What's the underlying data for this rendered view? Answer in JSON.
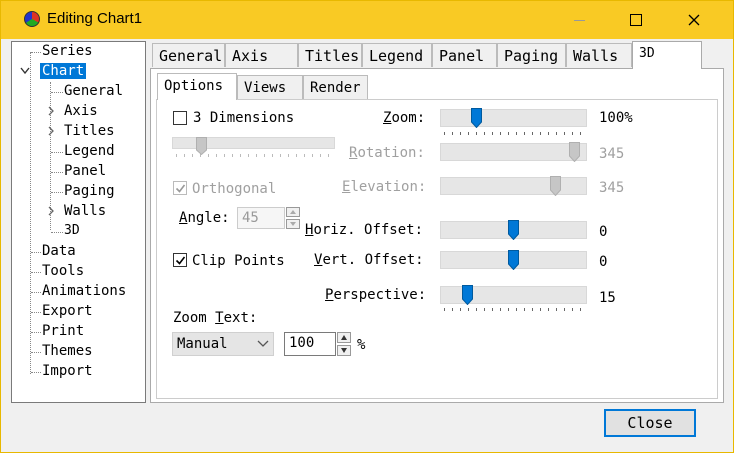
{
  "window": {
    "title": "Editing Chart1"
  },
  "tree": {
    "items": [
      {
        "label": "Series"
      },
      {
        "label": "Chart"
      },
      {
        "label": "General"
      },
      {
        "label": "Axis"
      },
      {
        "label": "Titles"
      },
      {
        "label": "Legend"
      },
      {
        "label": "Panel"
      },
      {
        "label": "Paging"
      },
      {
        "label": "Walls"
      },
      {
        "label": "3D"
      },
      {
        "label": "Data"
      },
      {
        "label": "Tools"
      },
      {
        "label": "Animations"
      },
      {
        "label": "Export"
      },
      {
        "label": "Print"
      },
      {
        "label": "Themes"
      },
      {
        "label": "Import"
      }
    ],
    "selected": "Chart"
  },
  "tabs": [
    "General",
    "Axis",
    "Titles",
    "Legend",
    "Panel",
    "Paging",
    "Walls",
    "3D"
  ],
  "active_tab": "3D",
  "subtabs": [
    "Options",
    "Views",
    "Render"
  ],
  "active_subtab": "Options",
  "options": {
    "three_dimensions": {
      "label": "3 Dimensions",
      "checked": false
    },
    "orthogonal": {
      "label": "Orthogonal",
      "checked": true,
      "enabled": false
    },
    "angle": {
      "label": "Angle:",
      "value": "45",
      "enabled": false
    },
    "clip_points": {
      "label": "Clip Points",
      "checked": true
    },
    "zoom_text": {
      "label": "Zoom Text:",
      "value": "Manual"
    },
    "zoom_text_percent": {
      "value": "100",
      "unit": "%"
    },
    "sliders": {
      "zoom": {
        "label": "Zoom:",
        "value": "100%",
        "level": 0.22,
        "enabled": true
      },
      "rotation": {
        "label": "Rotation:",
        "value": "345",
        "level": 0.96,
        "enabled": false
      },
      "elevation": {
        "label": "Elevation:",
        "value": "345",
        "level": 0.82,
        "enabled": false
      },
      "horiz_offset": {
        "label": "Horiz. Offset:",
        "value": "0",
        "level": 0.5,
        "enabled": true
      },
      "vert_offset": {
        "label": "Vert. Offset:",
        "value": "0",
        "level": 0.5,
        "enabled": true
      },
      "perspective": {
        "label": "Perspective:",
        "value": "15",
        "level": 0.15,
        "enabled": true
      }
    },
    "unnamed_slider": {
      "level": 0.15,
      "enabled": false
    }
  },
  "close_button": "Close",
  "colors": {
    "titlebar": "#f9ca24",
    "accent": "#0078d7",
    "thumb": "#0078d7"
  }
}
